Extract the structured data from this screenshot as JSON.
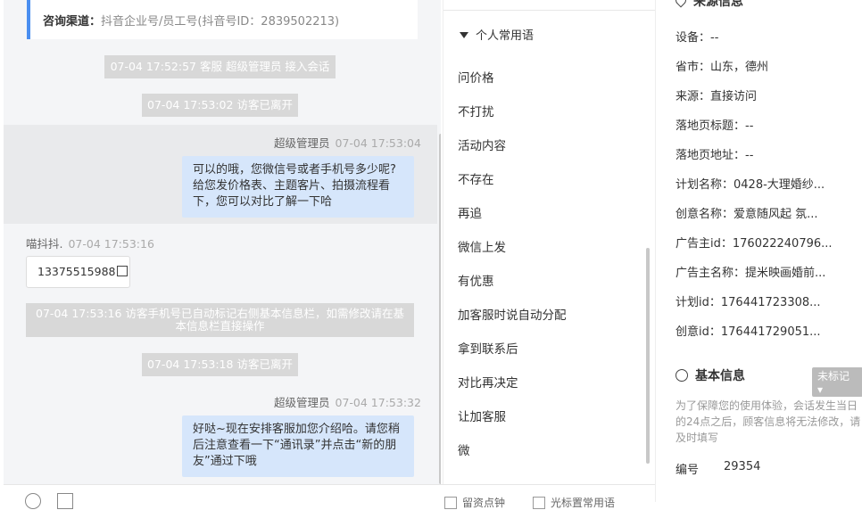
{
  "chat": {
    "channel": {
      "label": "咨询渠道：",
      "value": "抖音企业号/员工号(抖音号ID：2839502213)"
    },
    "sys1": "07-04 17:52:57 客服 超级管理员 接入会话",
    "sys2": "07-04 17:53:02 访客已离开",
    "msg1": {
      "name": "超级管理员",
      "time": "07-04 17:53:04",
      "text": "可以的哦，您微信号或者手机号多少呢?给您发价格表、主题客片、拍摄流程看下，您可以对比了解一下哈"
    },
    "msg2": {
      "name": "喵抖抖.",
      "time": "07-04 17:53:16",
      "text": "13375515988"
    },
    "sys3": "07-04 17:53:16 访客手机号已自动标记右侧基本信息栏，如需修改请在基本信息栏直接操作",
    "sys4": "07-04 17:53:18 访客已离开",
    "msg3": {
      "name": "超级管理员",
      "time": "07-04 17:53:32",
      "text": "好哒~现在安排客服加您介绍哈。请您稍后注意查看一下“通讯录”并点击“新的朋友”通过下哦"
    }
  },
  "phrases": {
    "group": "个人常用语",
    "items": [
      "问价格",
      "不打扰",
      "活动内容",
      "不存在",
      "再追",
      "微信上发",
      "有优惠",
      "加客服时说自动分配",
      "拿到联系后",
      "对比再决定",
      "让加客服",
      "微"
    ]
  },
  "footer": {
    "opt1": "留资点钟",
    "opt2": "光标置常用语"
  },
  "source": {
    "title": "来源信息",
    "rows": [
      {
        "label": "设备：",
        "value": "--"
      },
      {
        "label": "省市：",
        "value": "山东，德州"
      },
      {
        "label": "来源：",
        "value": "直接访问"
      },
      {
        "label": "落地页标题：",
        "value": "--"
      },
      {
        "label": "落地页地址：",
        "value": "--"
      },
      {
        "label": "计划名称：",
        "value": "0428-大理婚纱..."
      },
      {
        "label": "创意名称：",
        "value": "爱意随风起 氛..."
      },
      {
        "label": "广告主id：",
        "value": "176022240796..."
      },
      {
        "label": "广告主名称：",
        "value": "提米映画婚前..."
      },
      {
        "label": "计划id：",
        "value": "176441723308..."
      },
      {
        "label": "创意id：",
        "value": "176441729051..."
      }
    ]
  },
  "basic": {
    "title": "基本信息",
    "tag": "未标记",
    "note": "为了保障您的使用体验，会话发生当日的24点之后，顾客信息将无法修改，请及时填写",
    "id_label": "编号",
    "id_value": "29354"
  }
}
